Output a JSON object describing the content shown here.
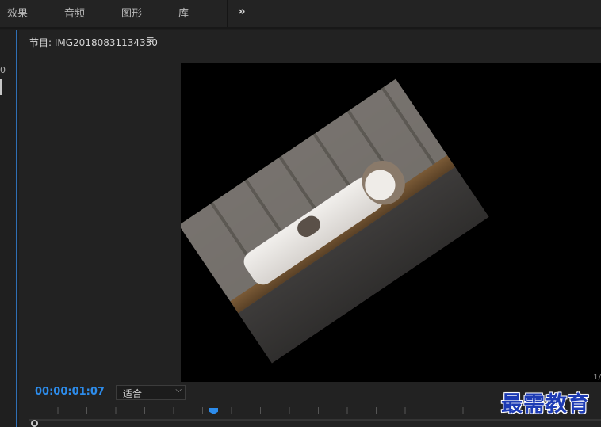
{
  "topbar": {
    "tabs": [
      "效果",
      "音频",
      "图形",
      "库"
    ],
    "overflow_glyph": "»"
  },
  "left_panel": {
    "digit": "0"
  },
  "monitor": {
    "title": "节目: IMG20180831134330",
    "menu_icon": "≡",
    "timecode": "00:00:01:07",
    "zoom": "适合",
    "zoom_chevron": "⌵",
    "corner_text": "1/"
  },
  "watermark": "最需教育",
  "colors": {
    "accent": "#2d8ceb",
    "watermark": "#1d3bb4"
  }
}
